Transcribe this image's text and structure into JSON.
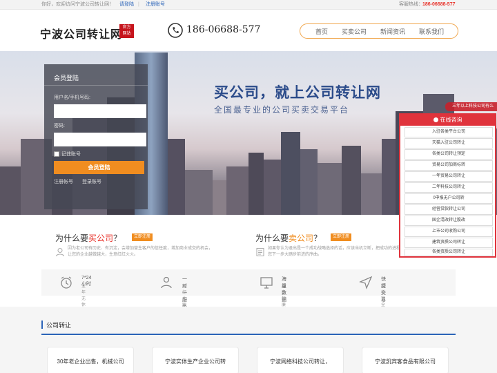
{
  "topbar": {
    "welcome": "你好，欢迎访问宁波公司转让网！",
    "login": "请登陆",
    "separator": "|",
    "register": "注册账号",
    "hotline_label": "客服热线：",
    "hotline": "186-06688-577"
  },
  "header": {
    "logo": "宁波公司转让网",
    "seal": [
      "官方",
      "网站"
    ],
    "phone": "186-06688-577",
    "phone_icon": "phone-icon",
    "nav": [
      "首页",
      "买卖公司",
      "新闻资讯",
      "联系我们"
    ]
  },
  "hero": {
    "slogan": "买公司，就上公司转让网",
    "subslogan": "全国最专业的公司买卖交易平台"
  },
  "login_box": {
    "title": "会员登陆",
    "user_label": "用户名/手机号码:",
    "password_label": "密码:",
    "remember_label": "记住账号",
    "submit": "会员登陆",
    "register": "注册帐号",
    "forgot": "登录账号"
  },
  "why": {
    "buy": {
      "prefix": "为什么要",
      "keyword": "买公司",
      "suffix": "？",
      "tag": "立即注册",
      "desc": "因为老公司有历史、有沉淀，会增加营生客户的信任度，增加商业成交的机会，让您的企业越做越大，生意红红火火。",
      "icon": "user-icon"
    },
    "sell": {
      "prefix": "为什么要",
      "keyword": "卖公司",
      "suffix": "？",
      "tag": "立即注册",
      "desc": "如果你认为退出是一个成功战略选择的话，应该当机立断，把成功的进程往往我您下一步大踏步前进的序曲。",
      "icon": "document-icon"
    }
  },
  "features": [
    {
      "title": "7*24小时",
      "desc": "全年无休24小时服务",
      "icon": "alarm-clock-icon"
    },
    {
      "title": "一对一服务",
      "desc": "经纪人跟进协助",
      "icon": "person-icon"
    },
    {
      "title": "海量数据",
      "desc": "超多的廉价转让数据",
      "icon": "monitor-icon"
    },
    {
      "title": "快捷交易",
      "desc": "完善安全的交易方式",
      "icon": "send-icon"
    }
  ],
  "section": {
    "title": "公司转让",
    "cards": [
      "30年老企业出售，机械公司",
      "宁波实体生产企业公司转",
      "宁波网络科技公司转让，",
      "宁波凯宾客食品有限公司"
    ]
  },
  "consult": {
    "tag": "三年以上科技公司有么",
    "header": "在线咨询",
    "items": [
      "入驻各类平台公司",
      "天猫入驻公司转让",
      "各类公司转让预定",
      "贸易公司加商标转",
      "一年贸易公司转让",
      "二年科技公司转让",
      "0申报无户公司转",
      "经营贷款转让公司",
      "国企混改转让股改",
      "上市公司收购公司",
      "建筑资质公司转让",
      "各类资质公司转让"
    ]
  },
  "colors": {
    "brand_blue": "#2a63b8",
    "accent_orange": "#f08d20",
    "consult_red": "#e0333c"
  }
}
